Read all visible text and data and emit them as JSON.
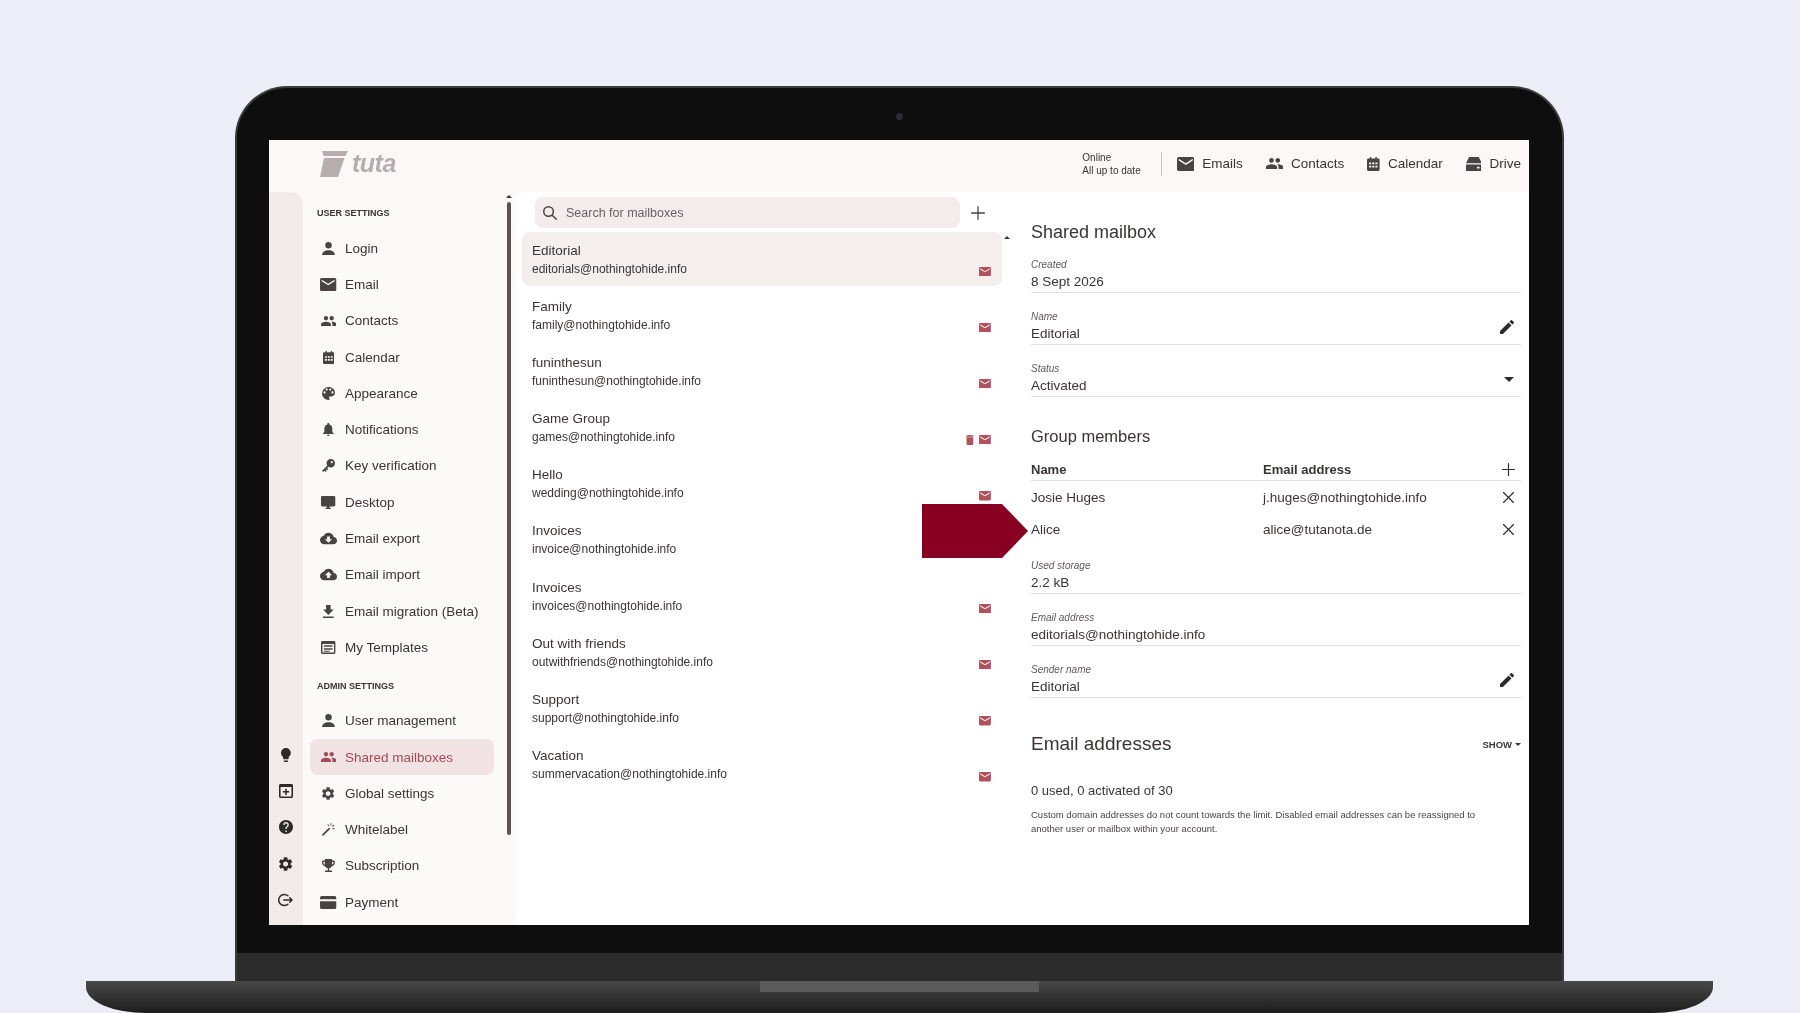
{
  "frame": {
    "kind": "laptop"
  },
  "header": {
    "logo": "tuta",
    "status": {
      "connection": "Online",
      "sync": "All up to date"
    },
    "nav": [
      {
        "label": "Emails",
        "kind": "mail"
      },
      {
        "label": "Contacts",
        "kind": "people"
      },
      {
        "label": "Calendar",
        "kind": "calendar"
      },
      {
        "label": "Drive",
        "kind": "drive"
      }
    ]
  },
  "rail": [
    {
      "kind": "bulb"
    },
    {
      "kind": "window-plus"
    },
    {
      "kind": "help"
    },
    {
      "kind": "gear"
    },
    {
      "kind": "logout"
    }
  ],
  "sidebar": {
    "sections": [
      {
        "heading": "USER SETTINGS",
        "items": [
          {
            "label": "Login",
            "kind": "person",
            "selected": false
          },
          {
            "label": "Email",
            "kind": "mail",
            "selected": false
          },
          {
            "label": "Contacts",
            "kind": "people",
            "selected": false
          },
          {
            "label": "Calendar",
            "kind": "calendar",
            "selected": false
          },
          {
            "label": "Appearance",
            "kind": "palette",
            "selected": false
          },
          {
            "label": "Notifications",
            "kind": "bell",
            "selected": false
          },
          {
            "label": "Key verification",
            "kind": "key",
            "selected": false
          },
          {
            "label": "Desktop",
            "kind": "monitor",
            "selected": false
          },
          {
            "label": "Email export",
            "kind": "cloud-down",
            "selected": false
          },
          {
            "label": "Email import",
            "kind": "cloud-up",
            "selected": false
          },
          {
            "label": "Email migration (Beta)",
            "kind": "download",
            "selected": false
          },
          {
            "label": "My Templates",
            "kind": "template",
            "selected": false
          }
        ]
      },
      {
        "heading": "ADMIN SETTINGS",
        "items": [
          {
            "label": "User management",
            "kind": "person",
            "selected": false
          },
          {
            "label": "Shared mailboxes",
            "kind": "people",
            "selected": true
          },
          {
            "label": "Global settings",
            "kind": "gear",
            "selected": false
          },
          {
            "label": "Whitelabel",
            "kind": "wand",
            "selected": false
          },
          {
            "label": "Subscription",
            "kind": "trophy",
            "selected": false
          },
          {
            "label": "Payment",
            "kind": "card",
            "selected": false
          }
        ]
      }
    ]
  },
  "mailbox_list": {
    "search": {
      "placeholder": "Search for mailboxes"
    },
    "items": [
      {
        "name": "Editorial",
        "address": "editorials@nothingtohide.info",
        "selected": true,
        "icons": [
          {
            "kind": "mail"
          }
        ]
      },
      {
        "name": "Family",
        "address": "family@nothingtohide.info",
        "selected": false,
        "icons": [
          {
            "kind": "mail"
          }
        ]
      },
      {
        "name": "funinthesun",
        "address": "funinthesun@nothingtohide.info",
        "selected": false,
        "icons": [
          {
            "kind": "mail"
          }
        ]
      },
      {
        "name": "Game Group",
        "address": "games@nothingtohide.info",
        "selected": false,
        "icons": [
          {
            "kind": "trash"
          },
          {
            "kind": "mail"
          }
        ]
      },
      {
        "name": "Hello",
        "address": "wedding@nothingtohide.info",
        "selected": false,
        "icons": [
          {
            "kind": "mail"
          }
        ]
      },
      {
        "name": "Invoices",
        "address": "invoice@nothingtohide.info",
        "selected": false
      },
      {
        "name": "Invoices",
        "address": "invoices@nothingtohide.info",
        "selected": false,
        "icons": [
          {
            "kind": "mail"
          }
        ]
      },
      {
        "name": "Out with friends",
        "address": "outwithfriends@nothingtohide.info",
        "selected": false,
        "icons": [
          {
            "kind": "mail"
          }
        ]
      },
      {
        "name": "Support",
        "address": "support@nothingtohide.info",
        "selected": false,
        "icons": [
          {
            "kind": "mail"
          }
        ]
      },
      {
        "name": "Vacation",
        "address": "summervacation@nothingtohide.info",
        "selected": false,
        "icons": [
          {
            "kind": "mail"
          }
        ]
      }
    ]
  },
  "detail": {
    "title": "Shared mailbox",
    "fields": [
      {
        "label": "Created",
        "value": "8 Sept 2026",
        "kind": "plain"
      },
      {
        "label": "Name",
        "value": "Editorial",
        "kind": "editable"
      },
      {
        "label": "Status",
        "value": "Activated",
        "kind": "dropdown"
      }
    ],
    "members": {
      "title": "Group members",
      "columns": [
        "Name",
        "Email address"
      ],
      "rows": [
        {
          "name": "Josie Huges",
          "email": "j.huges@nothingtohide.info"
        },
        {
          "name": "Alice",
          "email": "alice@tutanota.de"
        }
      ]
    },
    "more_fields": [
      {
        "label": "Used storage",
        "value": "2.2 kB",
        "kind": "plain"
      },
      {
        "label": "Email address",
        "value": "editorials@nothingtohide.info",
        "kind": "plain"
      },
      {
        "label": "Sender name",
        "value": "Editorial",
        "kind": "editable"
      }
    ],
    "email_addresses": {
      "title": "Email addresses",
      "toggle": "SHOW",
      "summary": "0 used, 0 activated of 30",
      "note": "Custom domain addresses do not count towards the limit. Disabled email addresses can be reassigned to another user or mailbox within your account."
    }
  },
  "annotation": {
    "kind": "arrow"
  }
}
